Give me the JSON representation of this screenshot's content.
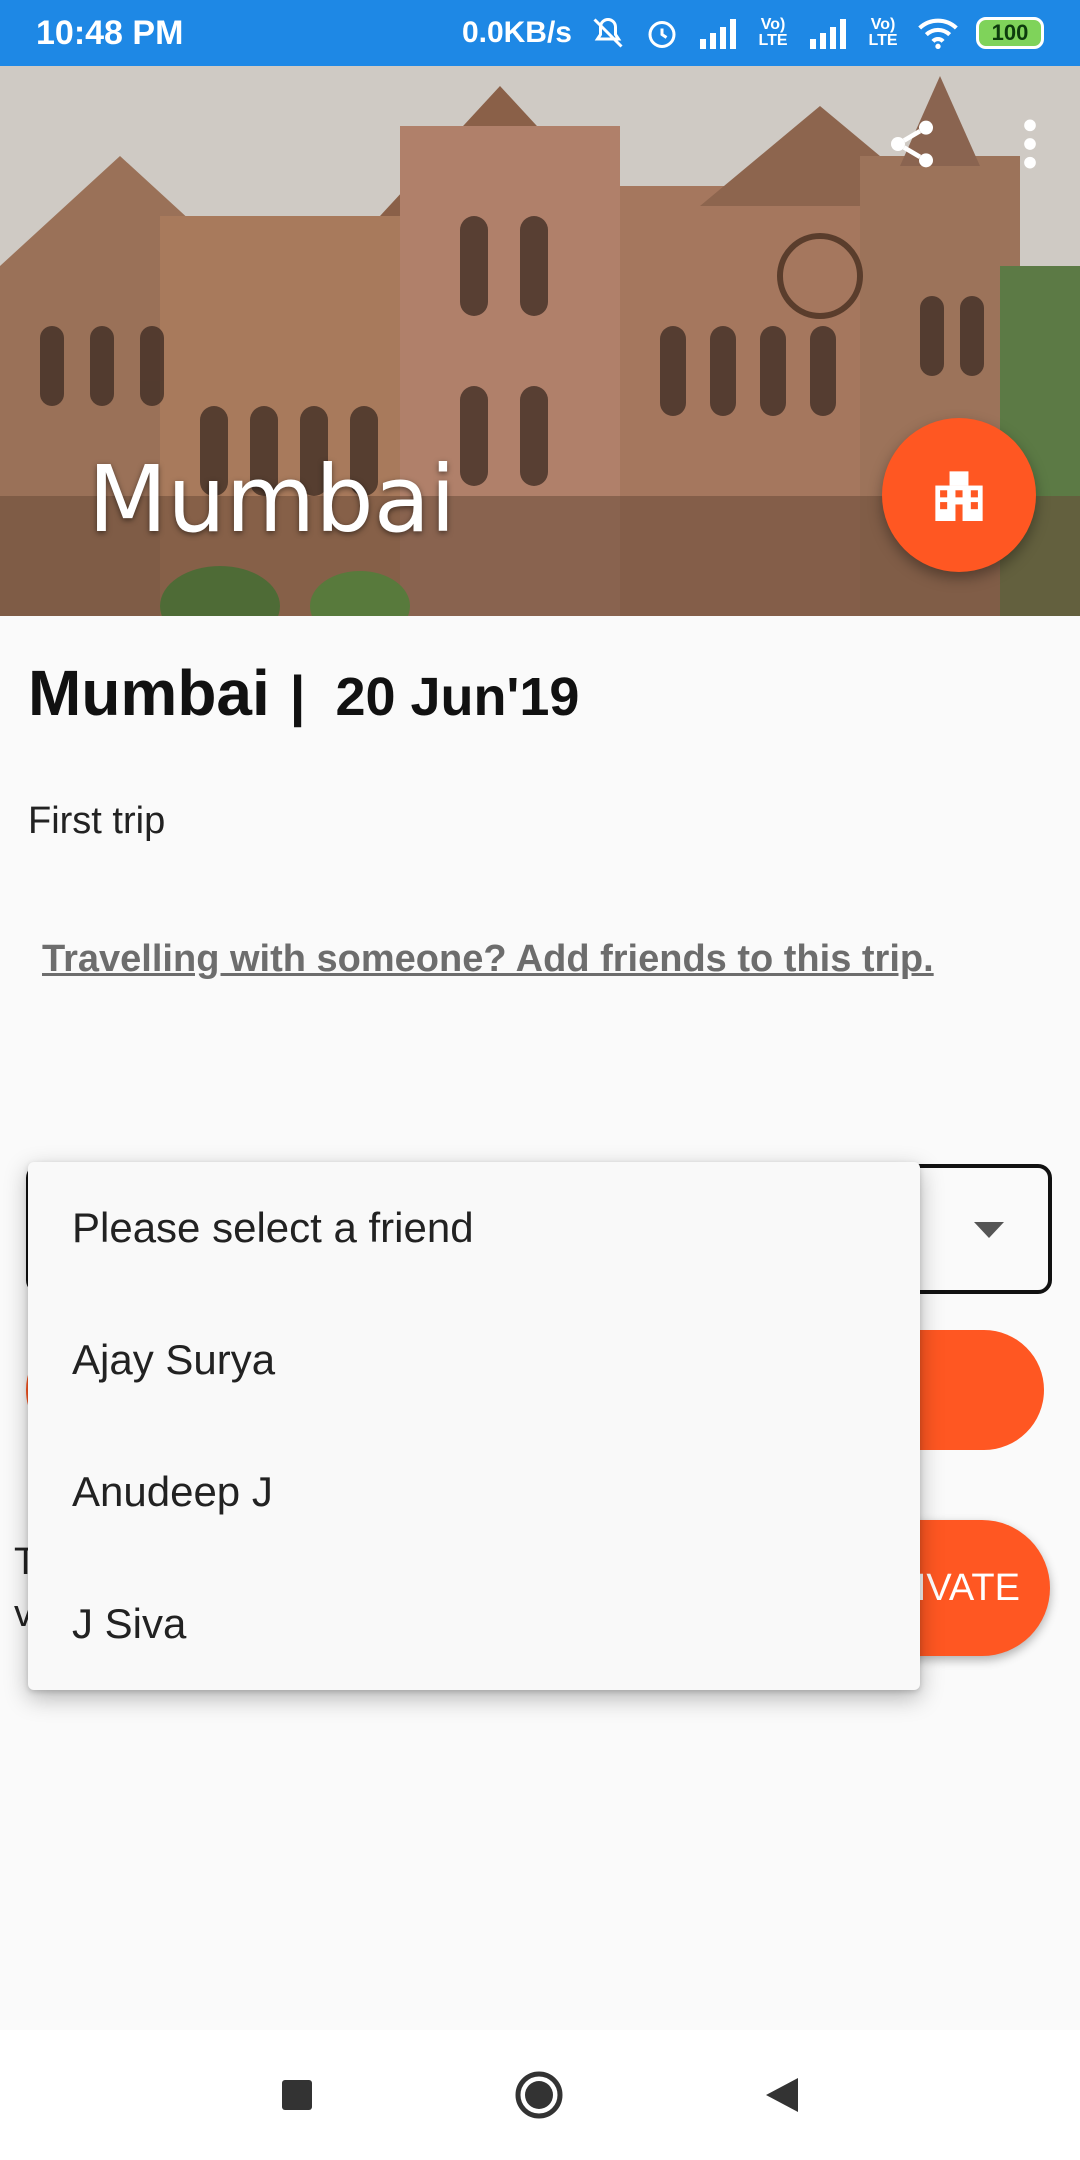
{
  "status_bar": {
    "time": "10:48 PM",
    "network_speed": "0.0KB/s",
    "battery": "100",
    "icons": [
      "mute-icon",
      "alarm-icon",
      "signal-icon",
      "volte-icon",
      "signal-icon",
      "volte-icon",
      "wifi-icon",
      "battery-icon"
    ],
    "volte_label": "Vo) LTE"
  },
  "hero": {
    "title": "Mumbai",
    "share_icon": "share-icon",
    "more_icon": "more-vert-icon",
    "fab_icon": "hotel-icon"
  },
  "trip": {
    "city": "Mumbai",
    "separator": "|",
    "date": "20 Jun'19",
    "description": "First trip",
    "add_friends_link": "Travelling with someone? Add friends to this trip."
  },
  "private_section": {
    "text_start": "T",
    "text_line2": "v",
    "button_label": "IVATE"
  },
  "dropdown": {
    "items": [
      "Please select a friend",
      "Ajay Surya",
      "Anudeep J",
      "J Siva"
    ]
  },
  "nav_bar": {
    "icons": [
      "recent-apps-icon",
      "home-icon",
      "back-icon"
    ]
  },
  "colors": {
    "status_bar": "#1e88e5",
    "accent": "#ff5722",
    "background": "#fafafa"
  }
}
